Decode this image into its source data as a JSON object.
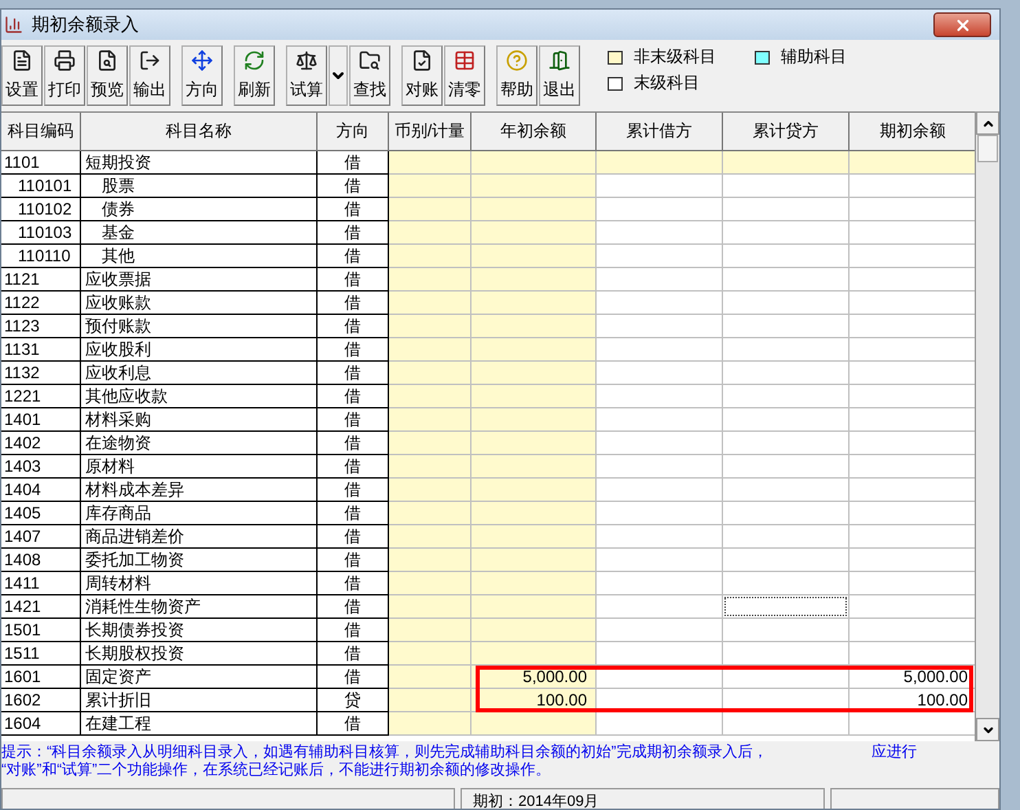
{
  "window": {
    "title": "期初余额录入"
  },
  "toolbar": [
    {
      "buttons": [
        {
          "label": "设置",
          "kind": "setup"
        },
        {
          "label": "打印",
          "kind": "print"
        },
        {
          "label": "预览",
          "kind": "preview"
        },
        {
          "label": "输出",
          "kind": "export"
        }
      ]
    },
    {
      "buttons": [
        {
          "label": "方向",
          "kind": "direction"
        }
      ]
    },
    {
      "buttons": [
        {
          "label": "刷新",
          "kind": "refresh"
        }
      ]
    },
    {
      "buttons": [
        {
          "label": "试算",
          "kind": "trial",
          "dropdown": true
        },
        {
          "label": "查找",
          "kind": "find"
        }
      ]
    },
    {
      "buttons": [
        {
          "label": "对账",
          "kind": "reconcile"
        },
        {
          "label": "清零",
          "kind": "clear"
        }
      ]
    },
    {
      "buttons": [
        {
          "label": "帮助",
          "kind": "help"
        },
        {
          "label": "退出",
          "kind": "exit"
        }
      ]
    }
  ],
  "legend": [
    {
      "label": "非末级科目",
      "color": "#fff8c8"
    },
    {
      "label": "辅助科目",
      "color": "#80ffff"
    },
    {
      "label": "末级科目",
      "color": "#ffffff"
    }
  ],
  "table": {
    "columns": [
      "科目编码",
      "科目名称",
      "方向",
      "币别/计量",
      "年初余额",
      "累计借方",
      "累计贷方",
      "期初余额"
    ],
    "rows": [
      {
        "code": "1101",
        "name": "短期投资",
        "direction": "借",
        "children": [
          {
            "code": "110101",
            "name": "股票",
            "direction": "借"
          },
          {
            "code": "110102",
            "name": "债券",
            "direction": "借"
          },
          {
            "code": "110103",
            "name": "基金",
            "direction": "借"
          },
          {
            "code": "110110",
            "name": "其他",
            "direction": "借"
          }
        ]
      },
      {
        "code": "1121",
        "name": "应收票据",
        "direction": "借"
      },
      {
        "code": "1122",
        "name": "应收账款",
        "direction": "借"
      },
      {
        "code": "1123",
        "name": "预付账款",
        "direction": "借"
      },
      {
        "code": "1131",
        "name": "应收股利",
        "direction": "借"
      },
      {
        "code": "1132",
        "name": "应收利息",
        "direction": "借"
      },
      {
        "code": "1221",
        "name": "其他应收款",
        "direction": "借"
      },
      {
        "code": "1401",
        "name": "材料采购",
        "direction": "借"
      },
      {
        "code": "1402",
        "name": "在途物资",
        "direction": "借"
      },
      {
        "code": "1403",
        "name": "原材料",
        "direction": "借"
      },
      {
        "code": "1404",
        "name": "材料成本差异",
        "direction": "借"
      },
      {
        "code": "1405",
        "name": "库存商品",
        "direction": "借"
      },
      {
        "code": "1407",
        "name": "商品进销差价",
        "direction": "借"
      },
      {
        "code": "1408",
        "name": "委托加工物资",
        "direction": "借"
      },
      {
        "code": "1411",
        "name": "周转材料",
        "direction": "借"
      },
      {
        "code": "1421",
        "name": "消耗性生物资产",
        "direction": "借",
        "focused": true
      },
      {
        "code": "1501",
        "name": "长期债券投资",
        "direction": "借"
      },
      {
        "code": "1511",
        "name": "长期股权投资",
        "direction": "借"
      },
      {
        "code": "1601",
        "name": "固定资产",
        "direction": "借",
        "year_start": "5,000.00",
        "opening": "5,000.00",
        "highlighted": true
      },
      {
        "code": "1602",
        "name": "累计折旧",
        "direction": "贷",
        "year_start": "100.00",
        "opening": "100.00",
        "highlighted": true
      },
      {
        "code": "1604",
        "name": "在建工程",
        "direction": "借"
      }
    ]
  },
  "hint": [
    "提示：“科目余额录入从明细科目录入，如遇有辅助科目核算，则先完成辅助科目余额的初始”完成期初余额录入后，",
    "应进行",
    "“对账”和“试算”二个功能操作，在系统已经记账后，不能进行期初余额的修改操作。"
  ],
  "status_bar": {
    "period": "期初：2014年09月"
  }
}
